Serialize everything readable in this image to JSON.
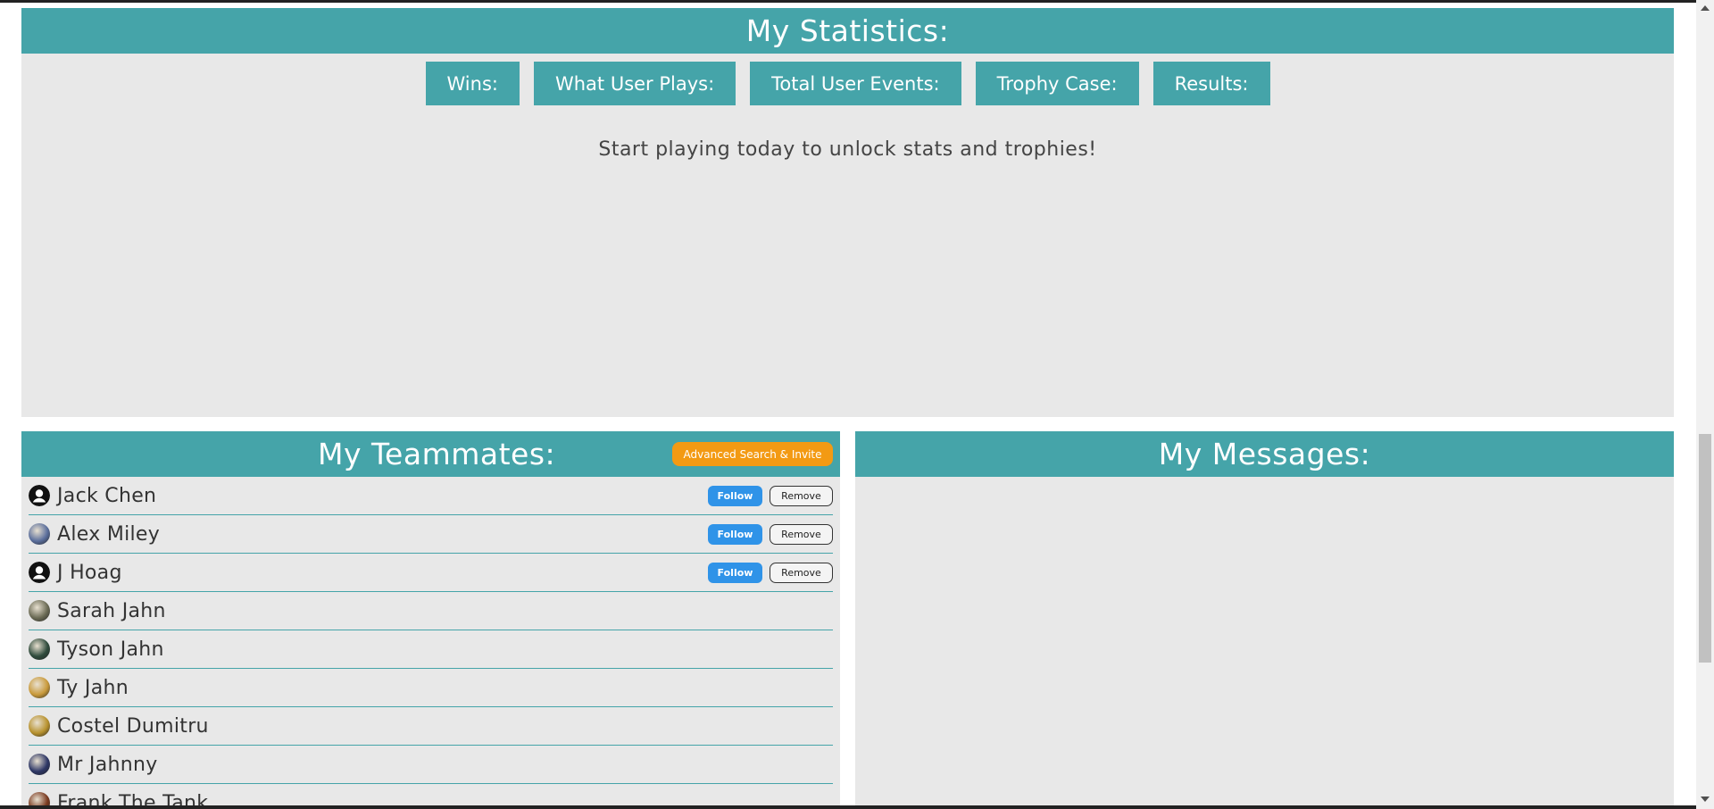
{
  "statistics": {
    "title": "My Statistics:",
    "tabs": [
      "Wins:",
      "What User Plays:",
      "Total User Events:",
      "Trophy Case:",
      "Results:"
    ],
    "empty_message": "Start playing today to unlock stats and trophies!"
  },
  "teammates": {
    "title": "My Teammates:",
    "advanced_search_label": "Advanced Search & Invite",
    "follow_label": "Follow",
    "remove_label": "Remove",
    "members": [
      {
        "name": "Jack Chen",
        "avatar": "default-user-icon",
        "actions": true
      },
      {
        "name": "Alex Miley",
        "avatar": "photo-avatar",
        "actions": true
      },
      {
        "name": "J Hoag",
        "avatar": "default-user-icon",
        "actions": true
      },
      {
        "name": "Sarah Jahn",
        "avatar": "photo-avatar",
        "actions": false
      },
      {
        "name": "Tyson Jahn",
        "avatar": "photo-avatar",
        "actions": false
      },
      {
        "name": "Ty Jahn",
        "avatar": "photo-avatar",
        "actions": false
      },
      {
        "name": "Costel Dumitru",
        "avatar": "photo-avatar",
        "actions": false
      },
      {
        "name": "Mr Jahnny",
        "avatar": "photo-avatar",
        "actions": false
      },
      {
        "name": "Frank The Tank",
        "avatar": "photo-avatar",
        "actions": false
      }
    ]
  },
  "messages": {
    "title": "My Messages:"
  },
  "colors": {
    "header_teal": "#45a4a9",
    "panel_gray": "#e8e8e8",
    "advanced_orange": "#f39a13",
    "follow_blue": "#2f93e8"
  }
}
